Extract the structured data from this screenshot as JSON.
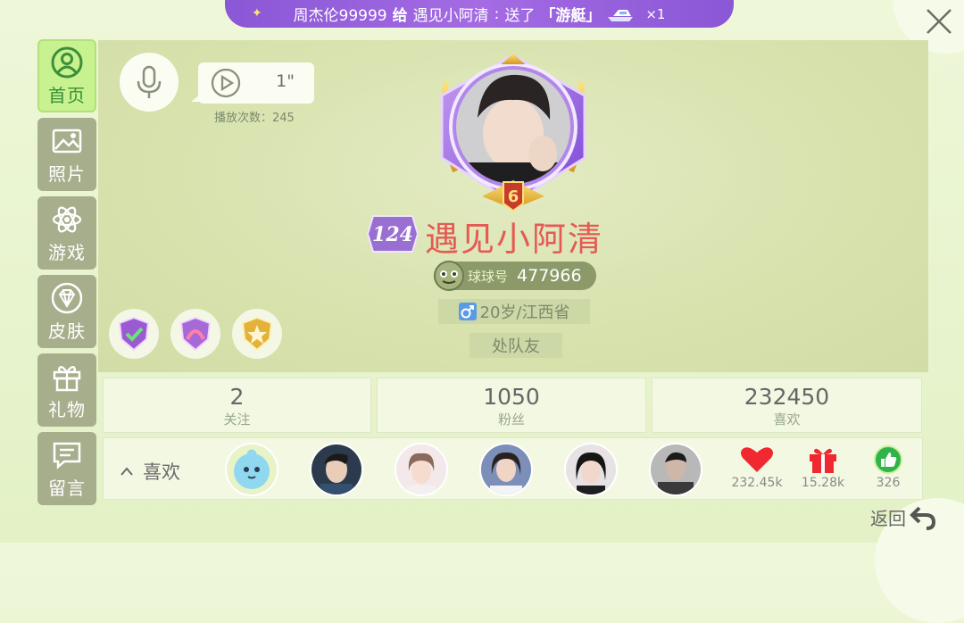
{
  "banner": {
    "sender": "周杰伦99999",
    "verb1": "给",
    "receiver": "遇见小阿清",
    "sep": ":",
    "verb2": "送了",
    "gift": "「游艇」",
    "count": "×1"
  },
  "sidebar": {
    "items": [
      {
        "label": "首页",
        "icon": "user-icon",
        "active": true
      },
      {
        "label": "照片",
        "icon": "image-icon"
      },
      {
        "label": "游戏",
        "icon": "atom-icon"
      },
      {
        "label": "皮肤",
        "icon": "diamond-icon"
      },
      {
        "label": "礼物",
        "icon": "gift-icon"
      },
      {
        "label": "留言",
        "icon": "message-icon"
      }
    ]
  },
  "voice": {
    "duration": "1\"",
    "play_count": "播放次数：245"
  },
  "profile": {
    "rank": "124",
    "level": "6",
    "nickname": "遇见小阿清",
    "id_label": "球球号",
    "id_value": "477966",
    "info": "20岁/江西省",
    "relation": "处队友"
  },
  "stats": [
    {
      "value": "2",
      "label": "关注"
    },
    {
      "value": "1050",
      "label": "粉丝"
    },
    {
      "value": "232450",
      "label": "喜欢"
    }
  ],
  "likes": {
    "title": "喜欢",
    "reactions": [
      {
        "icon": "heart-icon",
        "value": "232.45k"
      },
      {
        "icon": "gift-icon",
        "value": "15.28k"
      },
      {
        "icon": "thumbs-up-icon",
        "value": "326"
      }
    ]
  },
  "footer": {
    "back": "返回"
  },
  "colors": {
    "accent_green": "#c7f28f",
    "banner_purple": "#8a57d6",
    "nickname_red": "#e55a55"
  }
}
